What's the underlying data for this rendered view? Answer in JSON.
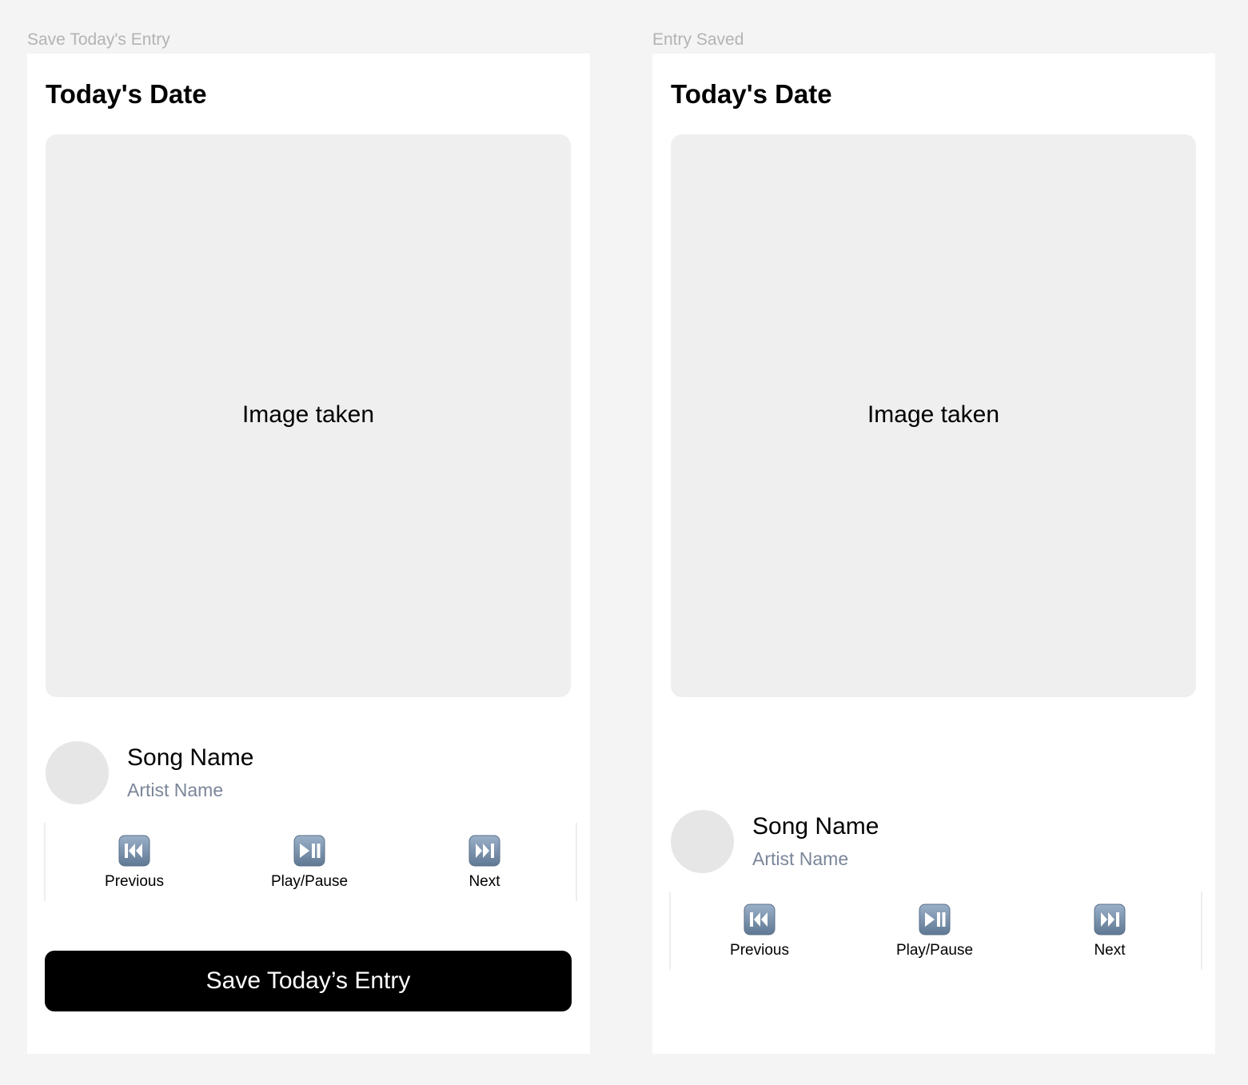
{
  "frames": [
    {
      "label": "Save Today's Entry",
      "date_title": "Today's Date",
      "image_placeholder": "Image taken",
      "song": {
        "name": "Song Name",
        "artist": "Artist Name"
      },
      "controls": {
        "previous": "Previous",
        "play_pause": "Play/Pause",
        "next": "Next"
      },
      "save_button": "Save Today’s Entry"
    },
    {
      "label": "Entry Saved",
      "date_title": "Today's Date",
      "image_placeholder": "Image taken",
      "song": {
        "name": "Song Name",
        "artist": "Artist Name"
      },
      "controls": {
        "previous": "Previous",
        "play_pause": "Play/Pause",
        "next": "Next"
      }
    }
  ],
  "icons": {
    "previous": "previous-track-icon",
    "play_pause": "play-pause-icon",
    "next": "next-track-icon"
  },
  "colors": {
    "canvas": "#f4f4f4",
    "frame": "#ffffff",
    "image_placeholder": "#efefef",
    "avatar": "#e6e6e6",
    "artist_text": "#7a8699",
    "icon": "#6e87a6",
    "save_button": "#000000"
  }
}
